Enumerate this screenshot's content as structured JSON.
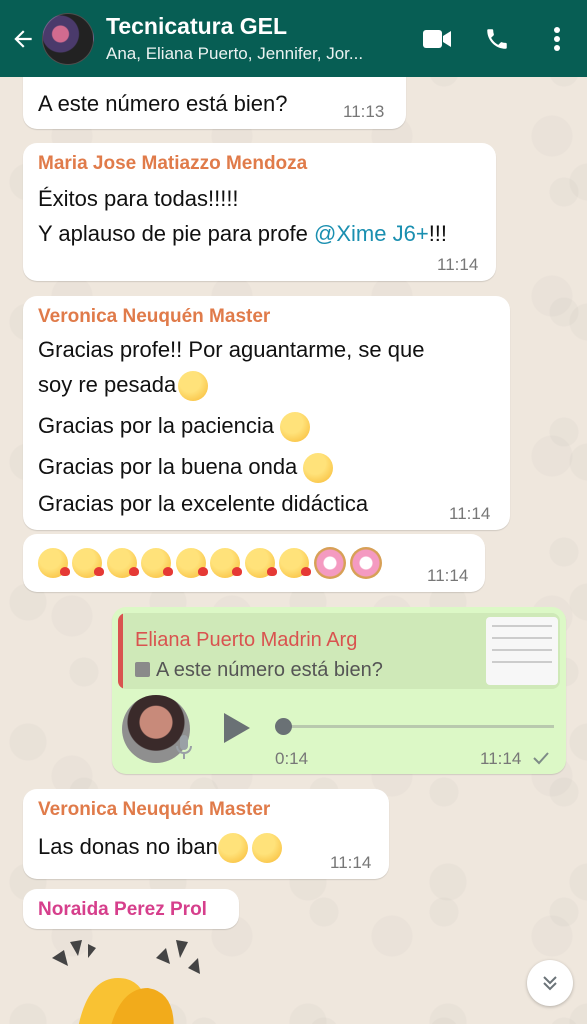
{
  "header": {
    "title": "Tecnicatura GEL",
    "members": "Ana, Eliana Puerto, Jennifer, Jor...",
    "back_icon": "arrow-left-icon",
    "video_icon": "video-camera-icon",
    "call_icon": "phone-icon",
    "menu_icon": "more-vertical-icon"
  },
  "colors": {
    "header": "#075e54",
    "incoming_bubble": "#ffffff",
    "outgoing_bubble": "#dcf8c6",
    "sender_orange": "#e07b4a",
    "sender_pink": "#d63f8c",
    "quote_bar": "#d9534f"
  },
  "messages": [
    {
      "text": "A este número está bien?",
      "time": "11:13"
    },
    {
      "sender": "Maria Jose Matiazzo Mendoza",
      "line1": "Éxitos para todas!!!!!",
      "line2_prefix": "Y aplauso de pie para profe ",
      "mention": "@Xime J6+",
      "line2_suffix": "!!!",
      "time": "11:14"
    },
    {
      "sender": "Veronica Neuquén Master",
      "line1": "Gracias profe!! Por aguantarme, se que",
      "line2": "soy re pesada",
      "line3": "Gracias por la paciencia",
      "line4": "Gracias por la buena onda",
      "line5": "Gracias por la excelente didáctica",
      "time": "11:14"
    },
    {
      "emoji_row": "kissing-face x8, donut x2",
      "time": "11:14"
    },
    {
      "quote_sender": "Eliana Puerto Madrin Arg",
      "quote_text": "A este número está bien?",
      "duration": "0:14",
      "time": "11:14",
      "status_icon": "single-check-icon"
    },
    {
      "sender": "Veronica Neuquén Master",
      "text": "Las donas no iban",
      "time": "11:14"
    },
    {
      "sender": "Noraida Perez Prol"
    }
  ]
}
